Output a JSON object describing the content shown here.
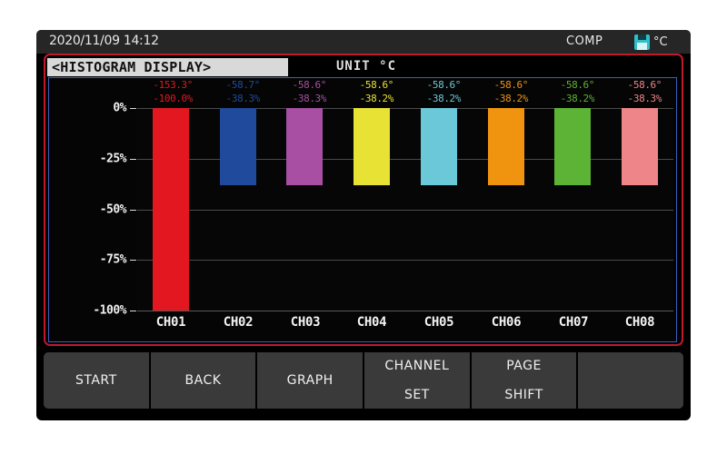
{
  "statusbar": {
    "datetime": "2020/11/09 14:12",
    "comp_label": "COMP",
    "unit": "°C",
    "media_icon": "floppy-disk-icon"
  },
  "header": {
    "title": "<HISTOGRAM DISPLAY>",
    "unit_label": "UNIT  °C"
  },
  "colors": {
    "frame_red": "#c0192b",
    "panel_border_blue": "#3a5fbf",
    "background": "#050505",
    "gridline": "#4a4a4a",
    "fkey_bg": "#3a3a3a",
    "media_icon": "#2fbfc9"
  },
  "chart_data": {
    "type": "bar",
    "title": "<HISTOGRAM DISPLAY>",
    "xlabel": "",
    "ylabel": "%",
    "ylim": [
      -100,
      0
    ],
    "yticks": [
      "0%",
      "-25%",
      "-50%",
      "-75%",
      "-100%"
    ],
    "ytick_values": [
      0,
      -25,
      -50,
      -75,
      -100
    ],
    "grid": true,
    "legend": "none",
    "unit": "°C",
    "categories": [
      "CH01",
      "CH02",
      "CH03",
      "CH04",
      "CH05",
      "CH06",
      "CH07",
      "CH08"
    ],
    "values": [
      -100.0,
      -38.3,
      -38.3,
      -38.2,
      -38.2,
      -38.2,
      -38.2,
      -38.3
    ],
    "temperatures": [
      -153.3,
      -58.7,
      -58.6,
      -58.6,
      -58.6,
      -58.6,
      -58.6,
      -58.6
    ],
    "temperature_labels": [
      "-153.3°",
      "-58.7°",
      "-58.6°",
      "-58.6°",
      "-58.6°",
      "-58.6°",
      "-58.6°",
      "-58.6°"
    ],
    "percent_labels": [
      "-100.0%",
      "-38.3%",
      "-38.3%",
      "-38.2%",
      "-38.2%",
      "-38.2%",
      "-38.2%",
      "-38.3%"
    ],
    "bar_colors": [
      "#e3171f",
      "#204a9c",
      "#a84fa3",
      "#e8e234",
      "#6ac8d8",
      "#f0930f",
      "#5cb335",
      "#ee8588"
    ]
  },
  "fkeys": [
    {
      "label": "START"
    },
    {
      "label": "BACK"
    },
    {
      "label": "GRAPH"
    },
    {
      "label": "CHANNEL\nSET"
    },
    {
      "label": "PAGE\nSHIFT"
    },
    {
      "label": ""
    }
  ]
}
